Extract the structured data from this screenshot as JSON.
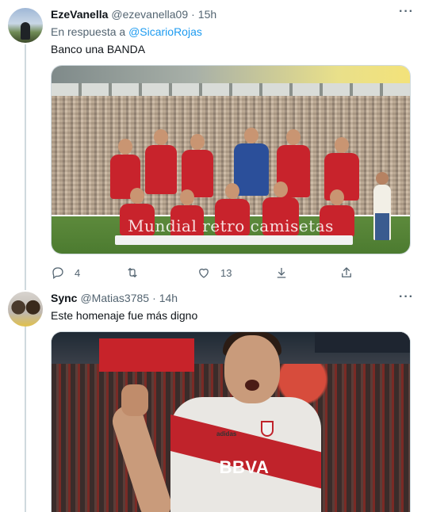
{
  "tweets": [
    {
      "author_name": "EzeVanella",
      "handle": "@ezevanella09",
      "separator": "·",
      "time": "15h",
      "reply_prefix": "En respuesta a",
      "reply_mention": "@SicarioRojas",
      "text": "Banco una BANDA",
      "media_overlay_text": "Mundial retro camisetas",
      "actions": {
        "reply_count": "4",
        "retweet_count": "",
        "like_count": "13"
      },
      "icons": [
        "reply-icon",
        "retweet-icon",
        "like-icon",
        "download-icon",
        "share-icon",
        "more-icon"
      ]
    },
    {
      "author_name": "Sync",
      "handle": "@Matias3785",
      "separator": "·",
      "time": "14h",
      "text": "Este homenaje fue más digno",
      "media_overlay_text": "BBVA",
      "icons": [
        "more-icon"
      ]
    }
  ],
  "colors": {
    "text_primary": "#0f1419",
    "text_secondary": "#536471",
    "link": "#1d9bf0",
    "border": "#cfd9de"
  }
}
